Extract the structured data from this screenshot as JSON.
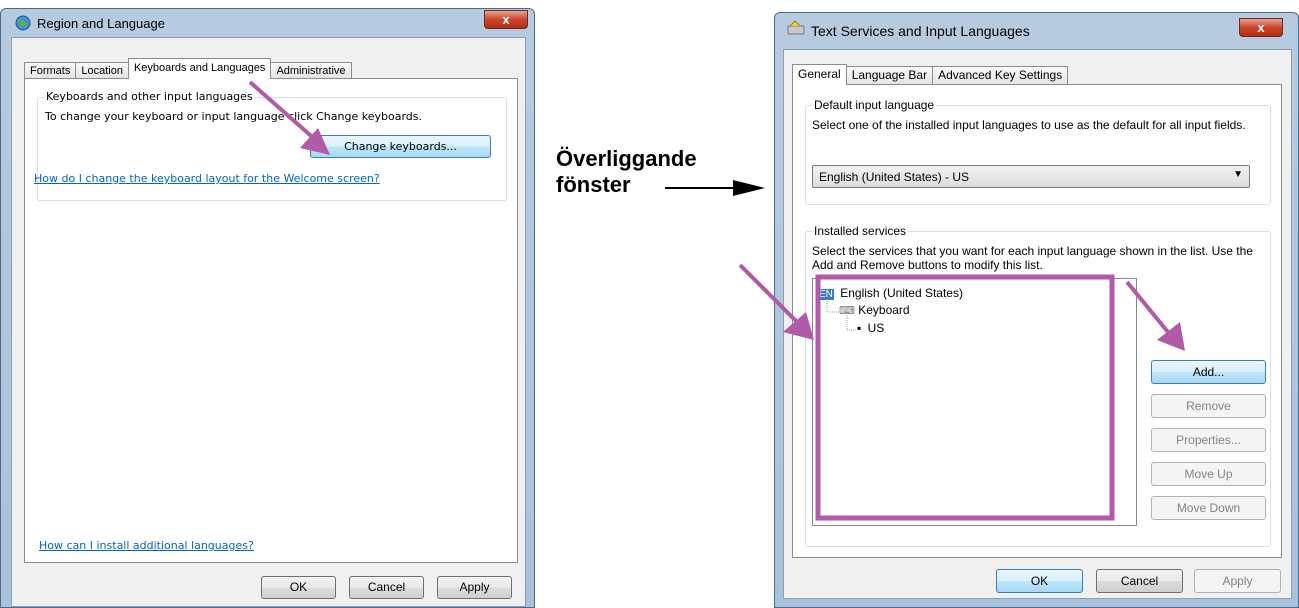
{
  "left_window": {
    "title": "Region and Language",
    "close_label": "x",
    "tabs": [
      {
        "label": "Formats"
      },
      {
        "label": "Location"
      },
      {
        "label": "Keyboards and Languages"
      },
      {
        "label": "Administrative"
      }
    ],
    "group_label": "Keyboards and other input languages",
    "group_text": "To change your keyboard or input language click Change keyboards.",
    "change_keyboards_button": "Change keyboards...",
    "welcome_link": "How do I change the keyboard layout for the Welcome screen?",
    "install_link": "How can I install additional languages?",
    "buttons": {
      "ok": "OK",
      "cancel": "Cancel",
      "apply": "Apply"
    }
  },
  "annotation": {
    "line1": "Överliggande",
    "line2": "fönster"
  },
  "right_window": {
    "title": "Text Services and Input Languages",
    "close_label": "x",
    "tabs": [
      {
        "label": "General"
      },
      {
        "label": "Language Bar"
      },
      {
        "label": "Advanced Key Settings"
      }
    ],
    "default_group": {
      "label": "Default input language",
      "description": "Select one of the installed input languages to use as the default for all input fields.",
      "selected": "English (United States) - US"
    },
    "services_group": {
      "label": "Installed services",
      "description": "Select the services that you want for each input language shown in the list. Use the Add and Remove buttons to modify this list.",
      "tree": {
        "badge": "EN",
        "language": "English (United States)",
        "category": "Keyboard",
        "layout": "US"
      }
    },
    "side_buttons": {
      "add": "Add...",
      "remove": "Remove",
      "properties": "Properties...",
      "move_up": "Move Up",
      "move_down": "Move Down"
    },
    "buttons": {
      "ok": "OK",
      "cancel": "Cancel",
      "apply": "Apply"
    }
  },
  "colors": {
    "highlight": "#b05aa8",
    "window_frame": "#a9c1da"
  }
}
